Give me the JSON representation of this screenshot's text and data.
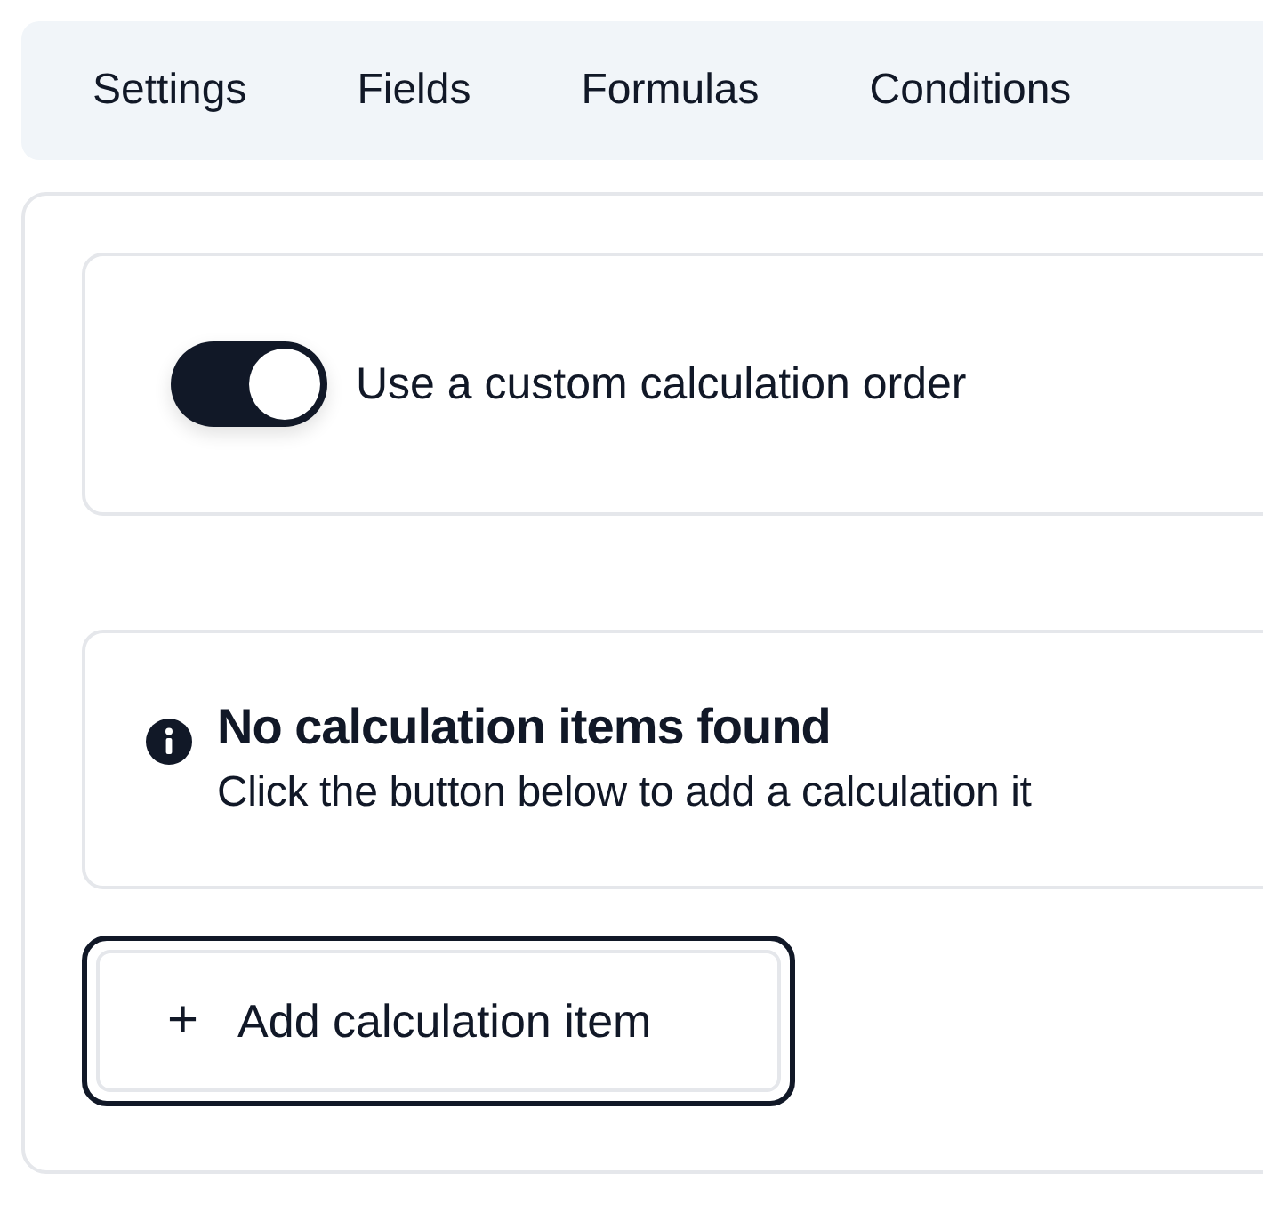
{
  "tabs": [
    {
      "label": "Settings",
      "selected": false
    },
    {
      "label": "Fields",
      "selected": false
    },
    {
      "label": "Formulas",
      "selected": false
    },
    {
      "label": "Conditions",
      "selected": false
    }
  ],
  "toggle": {
    "label": "Use a custom calculation order",
    "on": true
  },
  "notice": {
    "title": "No calculation items found",
    "text": "Click the button below to add a calculation it"
  },
  "add_button": {
    "icon": "+",
    "label": "Add calculation item",
    "focused": true
  }
}
